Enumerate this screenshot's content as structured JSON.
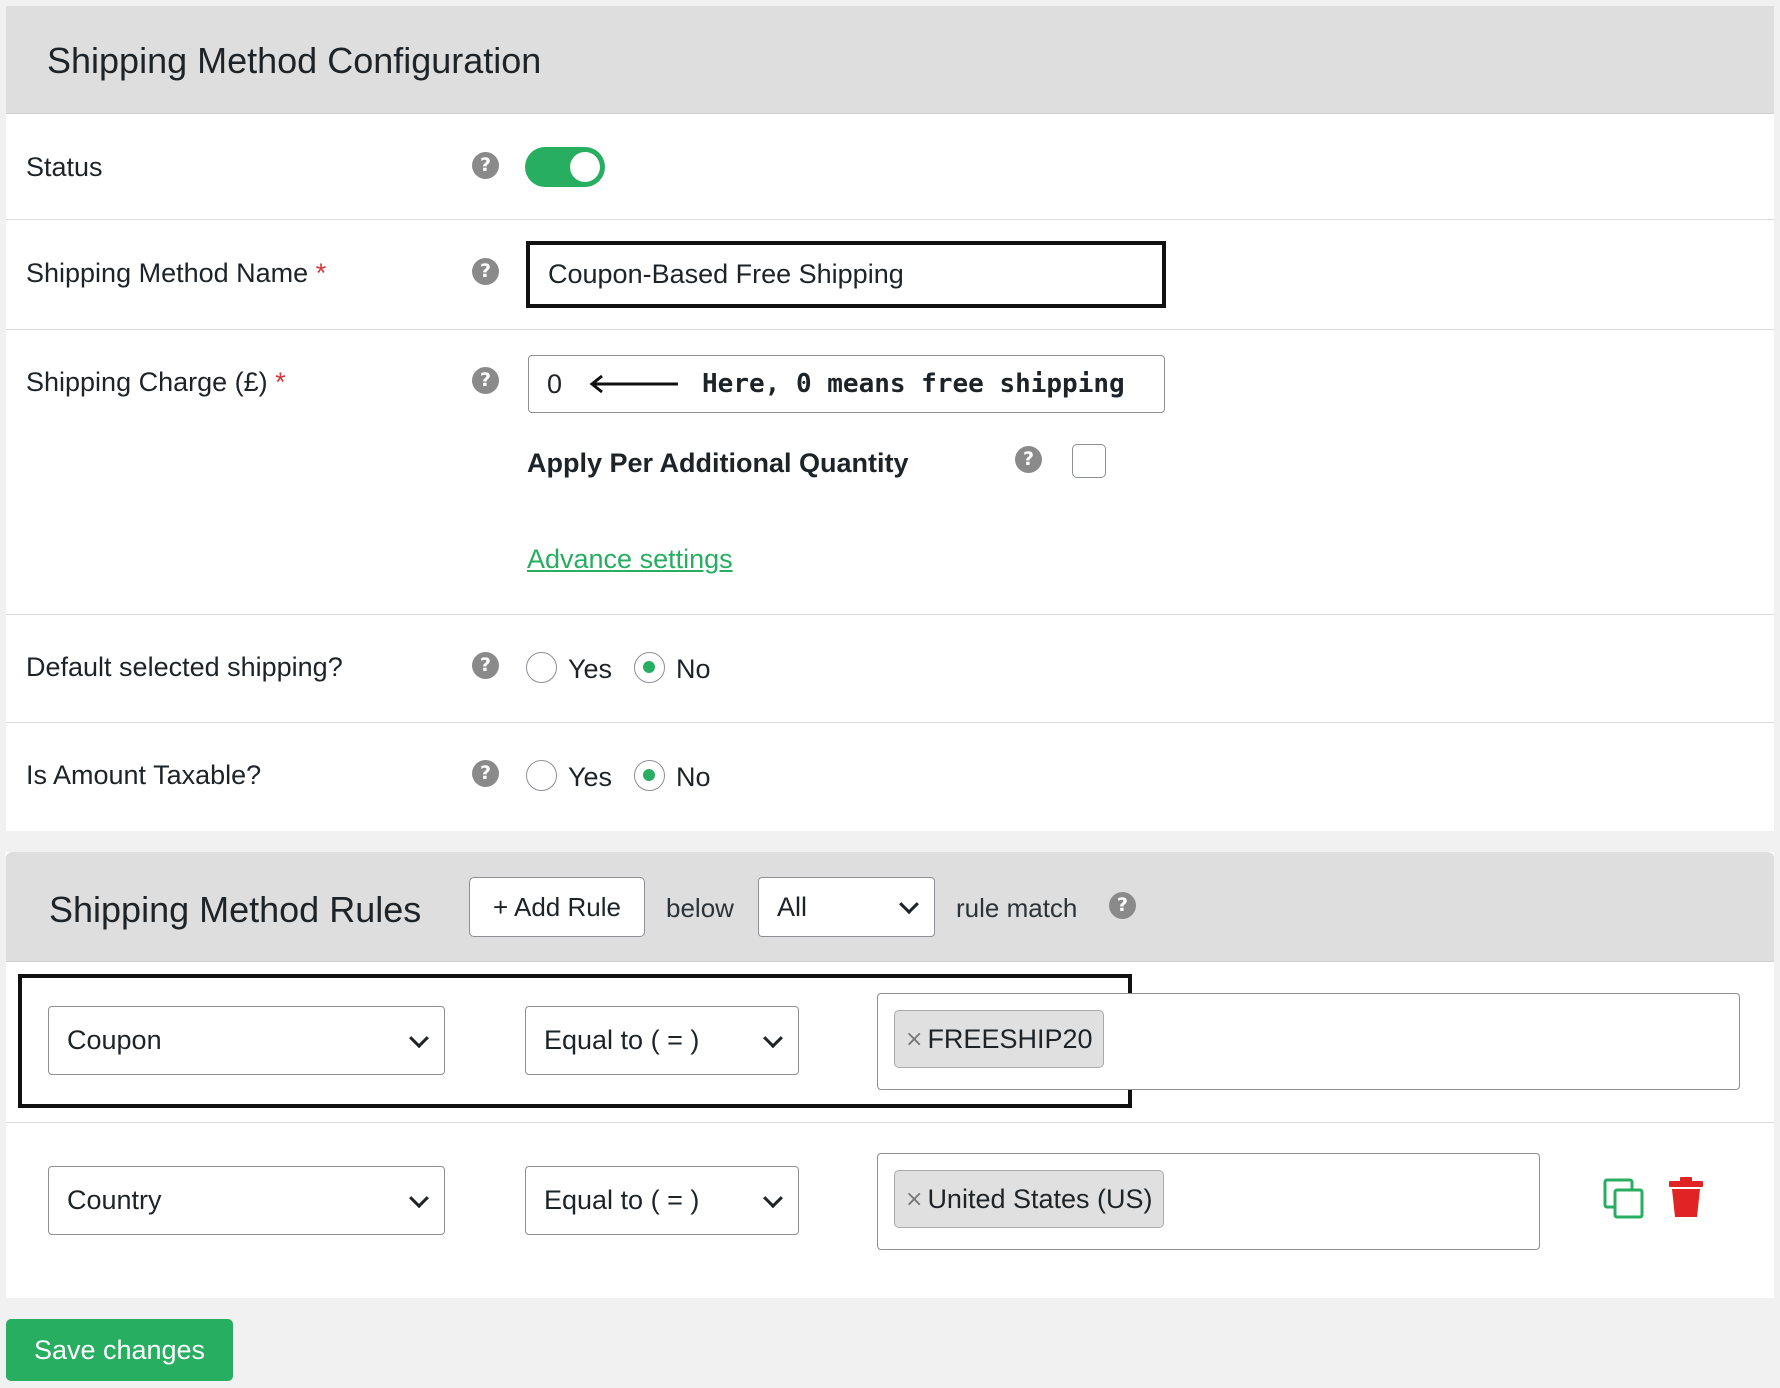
{
  "config": {
    "title": "Shipping Method Configuration",
    "status_label": "Status",
    "status_on": true,
    "name_label": "Shipping Method Name",
    "name_value": "Coupon-Based Free Shipping",
    "charge_label": "Shipping Charge (£)",
    "charge_value": "0",
    "charge_note": "Here, 0 means free shipping",
    "required_mark": "*",
    "per_qty_label": "Apply Per Additional Quantity",
    "advance_link": "Advance settings",
    "default_label": "Default selected shipping?",
    "taxable_label": "Is Amount Taxable?",
    "yes": "Yes",
    "no": "No",
    "help_glyph": "?"
  },
  "rules": {
    "title": "Shipping Method Rules",
    "add_rule": "+ Add Rule",
    "below": "below",
    "match_value": "All",
    "rule_match": "rule match",
    "items": [
      {
        "field": "Coupon",
        "operator": "Equal to ( = )",
        "value": "FREESHIP20"
      },
      {
        "field": "Country",
        "operator": "Equal to ( = )",
        "value": "United States (US)"
      }
    ]
  },
  "save_label": "Save changes",
  "colors": {
    "accent": "#27ae60",
    "danger": "#e02424"
  },
  "icons": {
    "copy": "copy-icon",
    "delete": "trash-icon",
    "help": "help-icon",
    "arrow": "arrow-left-icon"
  }
}
